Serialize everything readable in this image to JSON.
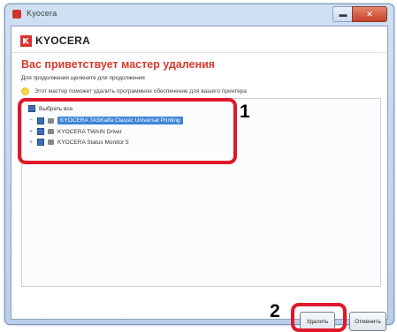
{
  "window": {
    "title": "Kyocera",
    "close_glyph": "✕",
    "minimize_glyph": "▬"
  },
  "logo": {
    "text": "KYOCERA"
  },
  "wizard": {
    "heading": "Вас приветствует мастер удаления",
    "subtitle": "Для продолжения щелкните для продолжения",
    "info_text": "Этот мастер поможет удалить программное обеспечение для вашего принтера"
  },
  "list": {
    "select_all_label": "Выбрать все",
    "items": [
      {
        "label": "KYOCERA TASKalfa Classic Universal Printing",
        "checked": true,
        "selected": true
      },
      {
        "label": "KYOCERA TWAIN Driver",
        "checked": true,
        "selected": false
      },
      {
        "label": "KYOCERA Status Monitor 5",
        "checked": true,
        "selected": false
      }
    ]
  },
  "callouts": [
    {
      "number": "1",
      "color": "#e1172b"
    },
    {
      "number": "2",
      "color": "#e1172b"
    }
  ],
  "buttons": {
    "delete": "Удалить",
    "cancel": "Отменить"
  }
}
